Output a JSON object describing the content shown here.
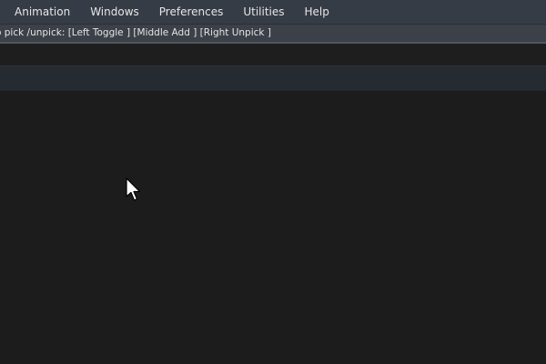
{
  "menubar": {
    "items": [
      {
        "label": "Animation"
      },
      {
        "label": "Windows"
      },
      {
        "label": "Preferences"
      },
      {
        "label": "Utilities"
      },
      {
        "label": "Help"
      }
    ]
  },
  "helpline": {
    "text": "o pick /unpick: [Left Toggle ] [Middle Add ] [Right Unpick ]"
  },
  "cursor": {
    "icon": "arrow-cursor-icon"
  },
  "colors": {
    "menubar_bg": "#363c46",
    "helpline_bg": "#3c4048",
    "main_bg": "#1c1c1c"
  }
}
